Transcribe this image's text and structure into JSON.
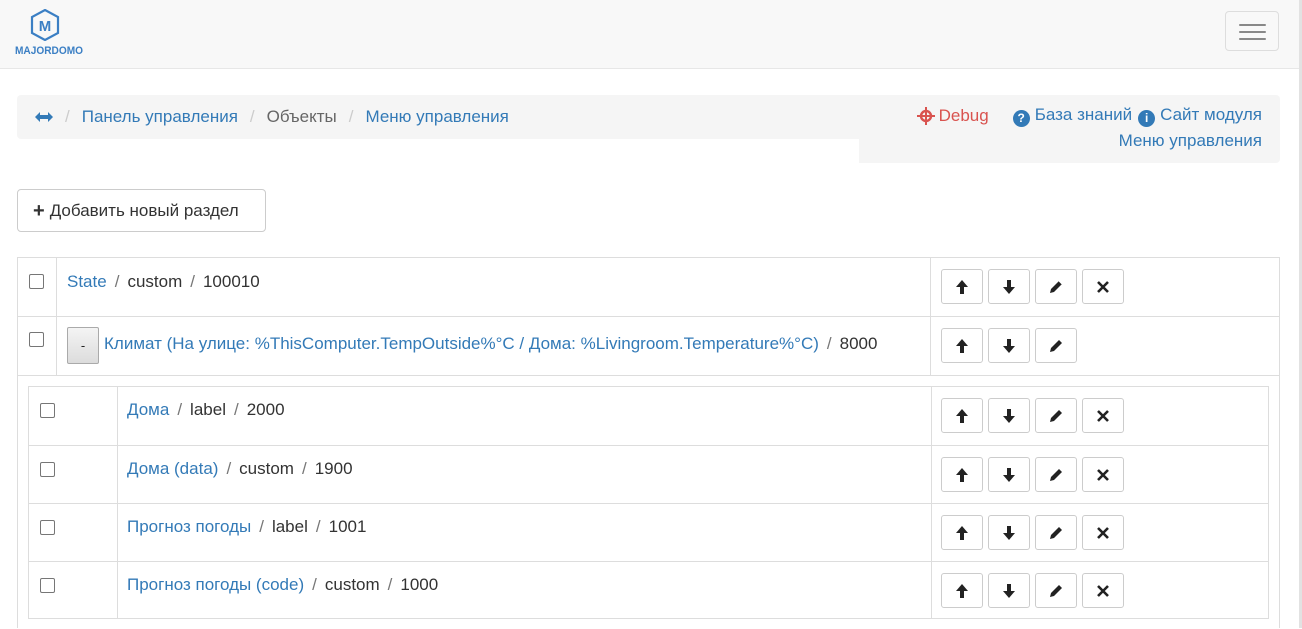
{
  "logo": {
    "text": "MAJORDOMO",
    "letter": "M"
  },
  "breadcrumb": {
    "items": [
      "Панель управления",
      "Объекты",
      "Меню управления"
    ],
    "separator": "/"
  },
  "right_panel": {
    "debug": "Debug",
    "knowledge_base": "База знаний",
    "module_site": "Сайт модуля",
    "module_name": "Меню управления"
  },
  "add_button": "Добавить новый раздел",
  "separator": "/",
  "rows": [
    {
      "title": "State",
      "type": "custom",
      "priority": "100010"
    },
    {
      "title": "Климат (На улице: %ThisComputer.TempOutside%°C / Дома: %Livingroom.Temperature%°C)",
      "priority": "8000",
      "collapse_label": "-"
    }
  ],
  "children": [
    {
      "title": "Дома",
      "type": "label",
      "priority": "2000"
    },
    {
      "title": "Дома (data)",
      "type": "custom",
      "priority": "1900"
    },
    {
      "title": "Прогноз погоды",
      "type": "label",
      "priority": "1001"
    },
    {
      "title": "Прогноз погоды (code)",
      "type": "custom",
      "priority": "1000"
    }
  ],
  "colors": {
    "link": "#337ab7",
    "debug": "#d9534f",
    "logo": "#3b7fc4"
  }
}
